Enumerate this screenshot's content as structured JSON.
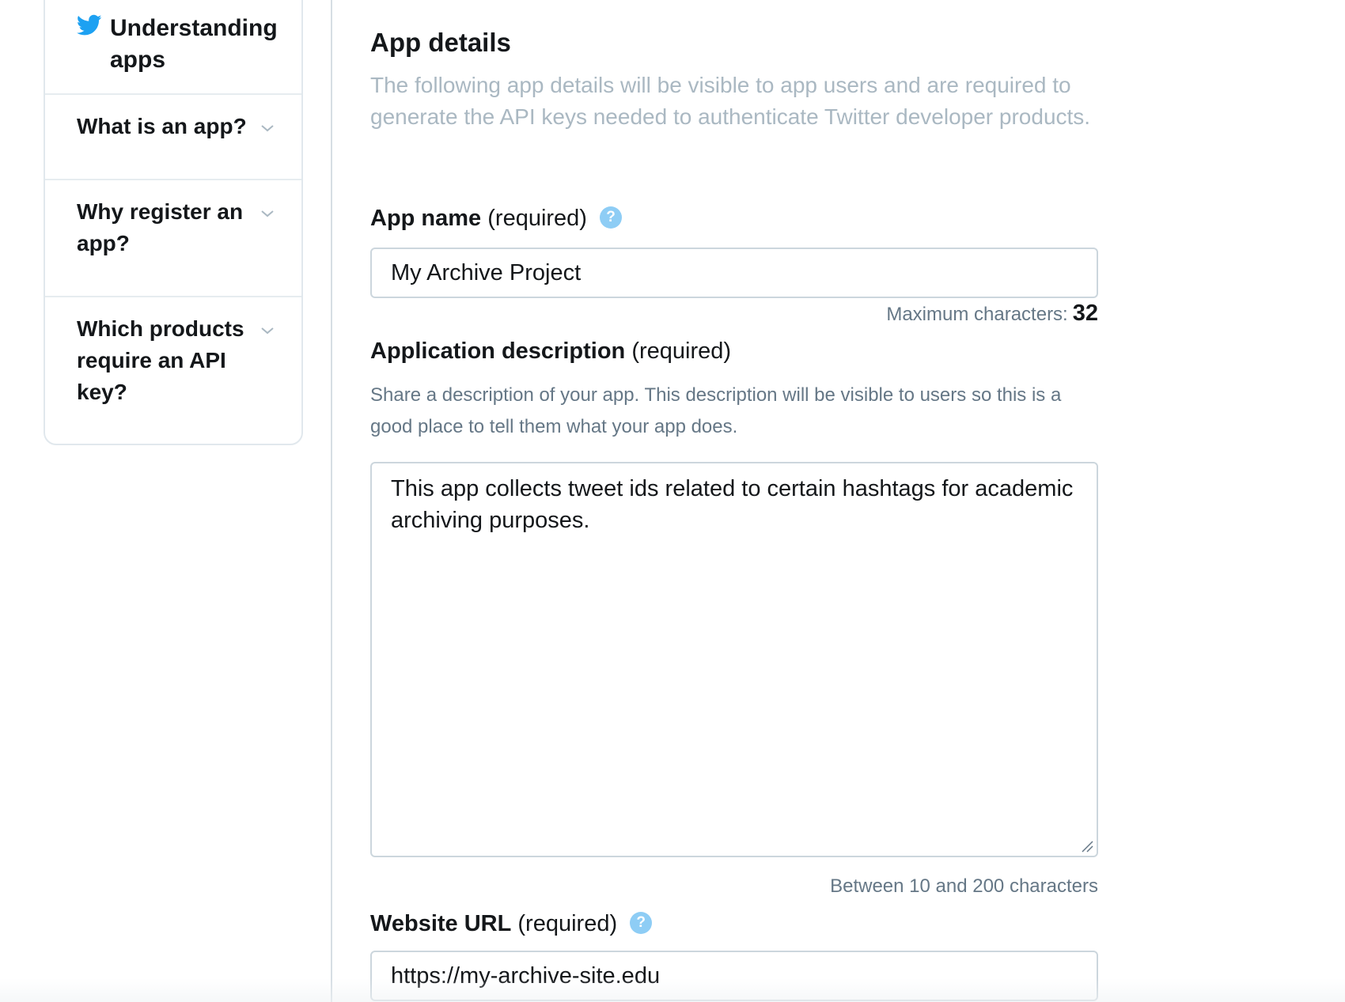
{
  "sidebar": {
    "title": "Understanding apps",
    "items": [
      {
        "label": "What is an app?"
      },
      {
        "label": "Why register an app?"
      },
      {
        "label": "Which products require an API key?"
      }
    ]
  },
  "main": {
    "section_title": "App details",
    "section_description": "The following app details will be visible to app users and are required to generate the API keys needed to authenticate Twitter developer products.",
    "app_name": {
      "label": "App name",
      "required": "(required)",
      "help": "?",
      "value": "My Archive Project",
      "hint_label": "Maximum characters:",
      "hint_value": "32"
    },
    "description": {
      "label": "Application description",
      "required": "(required)",
      "help_text": "Share a description of your app. This description will be visible to users so this is a good place to tell them what your app does.",
      "value": "This app collects tweet ids related to certain hashtags for academic archiving purposes.",
      "hint": "Between 10 and 200 characters"
    },
    "website": {
      "label": "Website URL",
      "required": "(required)",
      "help": "?",
      "value": "https://my-archive-site.edu"
    }
  },
  "colors": {
    "twitter_blue": "#1da1f2",
    "help_icon": "#8ecdf5",
    "muted_text": "#aab8c2",
    "secondary_text": "#657786",
    "border": "#ccd6dd"
  },
  "icons": [
    "twitter-bird-icon",
    "chevron-down-icon",
    "help-icon",
    "resize-grip-icon"
  ]
}
